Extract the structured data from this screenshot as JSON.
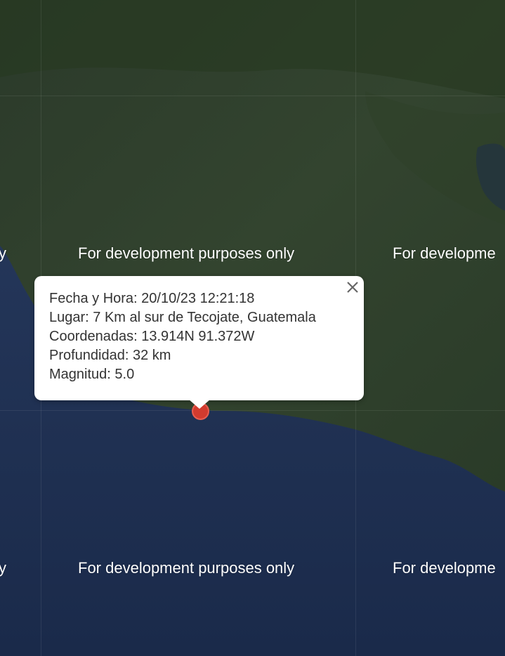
{
  "map": {
    "watermark_text": "For development purposes only",
    "watermark_partial_left": "y",
    "watermark_partial_right": "For developme"
  },
  "popup": {
    "lines": [
      "Fecha y Hora: 20/10/23 12:21:18",
      "Lugar: 7 Km al sur de Tecojate, Guatemala",
      "Coordenadas: 13.914N 91.372W",
      "Profundidad: 32 km",
      "Magnitud: 5.0"
    ],
    "close_icon": "close-icon"
  },
  "marker": {
    "icon": "earthquake-marker",
    "color": "#d23b2f"
  }
}
